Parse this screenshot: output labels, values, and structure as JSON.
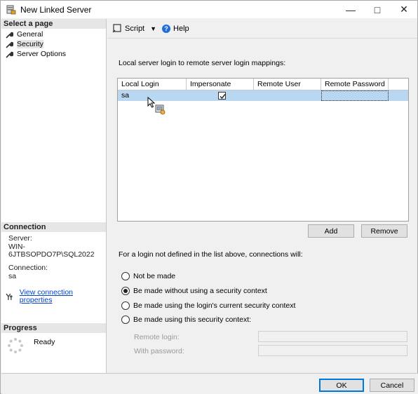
{
  "window": {
    "title": "New Linked Server",
    "minimize_glyph": "—",
    "maximize_glyph": "□",
    "close_glyph": "✕"
  },
  "left": {
    "select_page_header": "Select a page",
    "pages": [
      {
        "label": "General",
        "icon": "wrench-icon",
        "selected": false
      },
      {
        "label": "Security",
        "icon": "wrench-icon",
        "selected": true
      },
      {
        "label": "Server Options",
        "icon": "wrench-icon",
        "selected": false
      }
    ],
    "connection_header": "Connection",
    "server_label": "Server:",
    "server_value": "WIN-6JTBSOPDO7P\\SQL2022",
    "connection_label": "Connection:",
    "connection_value": "sa",
    "view_properties_link": "View connection properties",
    "progress_header": "Progress",
    "progress_status": "Ready"
  },
  "toolbar": {
    "script_label": "Script",
    "help_label": "Help"
  },
  "main": {
    "mapping_label": "Local server login to remote server login mappings:",
    "grid": {
      "columns": [
        "Local Login",
        "Impersonate",
        "Remote User",
        "Remote Password"
      ],
      "rows": [
        {
          "local_login": "sa",
          "impersonate": true,
          "remote_user": "",
          "remote_password": ""
        }
      ]
    },
    "add_label": "Add",
    "remove_label": "Remove",
    "fallback_label": "For a login not defined in the list above, connections will:",
    "options": [
      {
        "label": "Not be made",
        "checked": false
      },
      {
        "label": "Be made without using a security context",
        "checked": true
      },
      {
        "label": "Be made using the login's current security context",
        "checked": false
      },
      {
        "label": "Be made using this security context:",
        "checked": false
      }
    ],
    "remote_login_label": "Remote login:",
    "with_password_label": "With password:"
  },
  "footer": {
    "ok_label": "OK",
    "cancel_label": "Cancel"
  },
  "colors": {
    "selected_row": "#b9d7f1",
    "link": "#0044cc",
    "help_icon": "#1e6fd9",
    "primary_border": "#0078d7"
  }
}
